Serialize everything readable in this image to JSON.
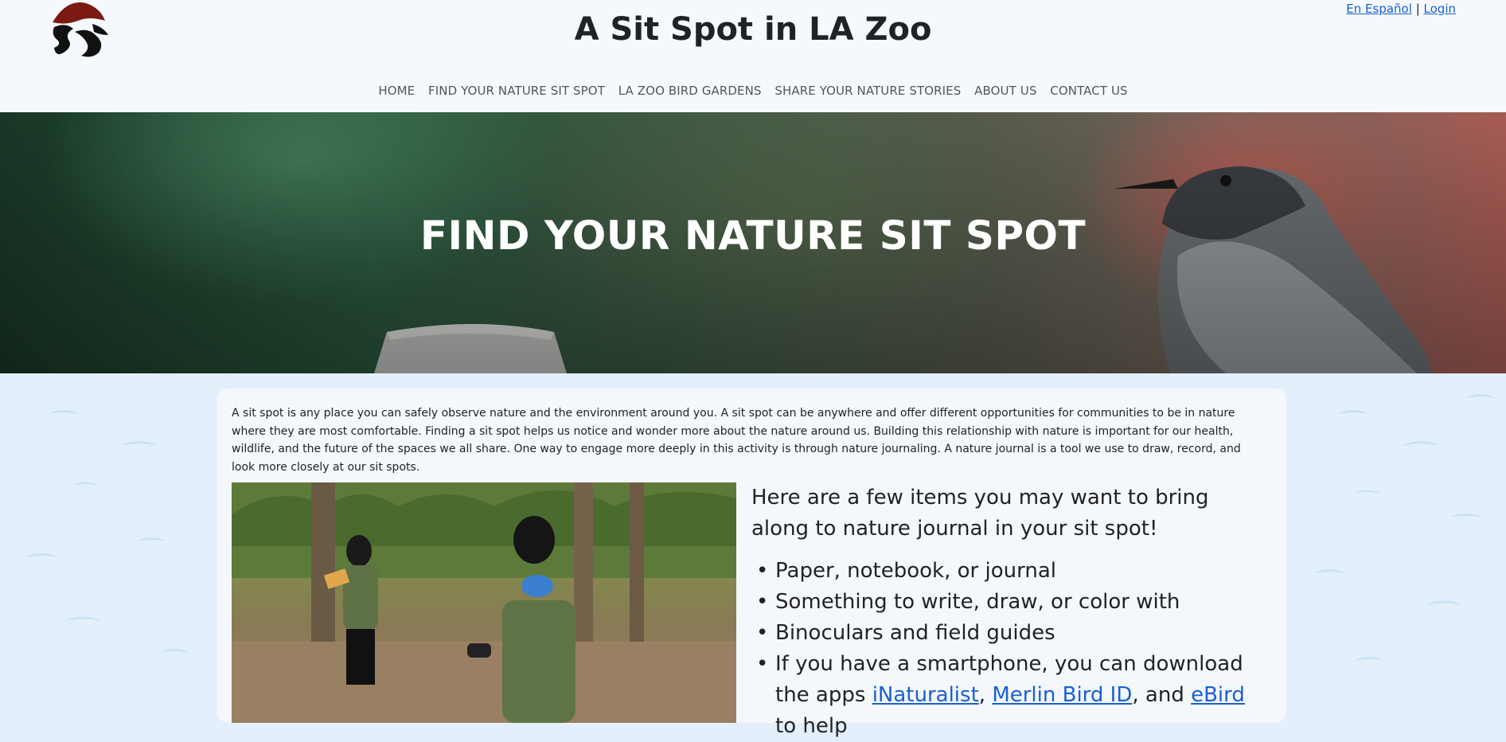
{
  "header": {
    "site_title": "A Sit Spot in LA Zoo",
    "language_link": "En Español",
    "separator": "|",
    "login_link": "Login",
    "logo_icon": "la-zoo-logo-icon",
    "nav": [
      "HOME",
      "FIND YOUR NATURE SIT SPOT",
      "LA ZOO BIRD GARDENS",
      "SHARE YOUR NATURE STORIES",
      "ABOUT US",
      "CONTACT US"
    ]
  },
  "hero": {
    "title": "FIND YOUR NATURE SIT SPOT",
    "image_icon": "black-phoebe-bird-photo"
  },
  "main": {
    "intro": "A sit spot is any place you can safely observe nature and the environment around you. A sit spot can be anywhere and offer different opportunities for communities to be in nature where they are most comfortable. Finding a sit spot helps us notice and wonder more about the nature around us. Building this relationship with nature is important for our health, wildlife, and the future of the spaces we all share. One way to engage more deeply in this activity is through nature journaling. A nature journal is a tool we use to draw, record, and look more closely at our sit spots.",
    "photo_icon": "people-nature-journaling-photo",
    "list_intro": "Here are a few items you may want to bring along to nature journal in your sit spot!",
    "items": [
      "Paper, notebook, or journal",
      "Something to write, draw, or color with",
      "Binoculars and field guides"
    ],
    "apps_item": {
      "prefix": "If you have a smartphone, you can download the apps ",
      "link1": "iNaturalist",
      "sep1": ", ",
      "link2": "Merlin Bird ID",
      "sep2": ", and ",
      "link3": "eBird",
      "suffix": " to help"
    }
  },
  "colors": {
    "background": "#e3f0fb",
    "header_bg": "#f5f9fd",
    "link": "#1a5fd0",
    "logo": "#7a1a10"
  }
}
